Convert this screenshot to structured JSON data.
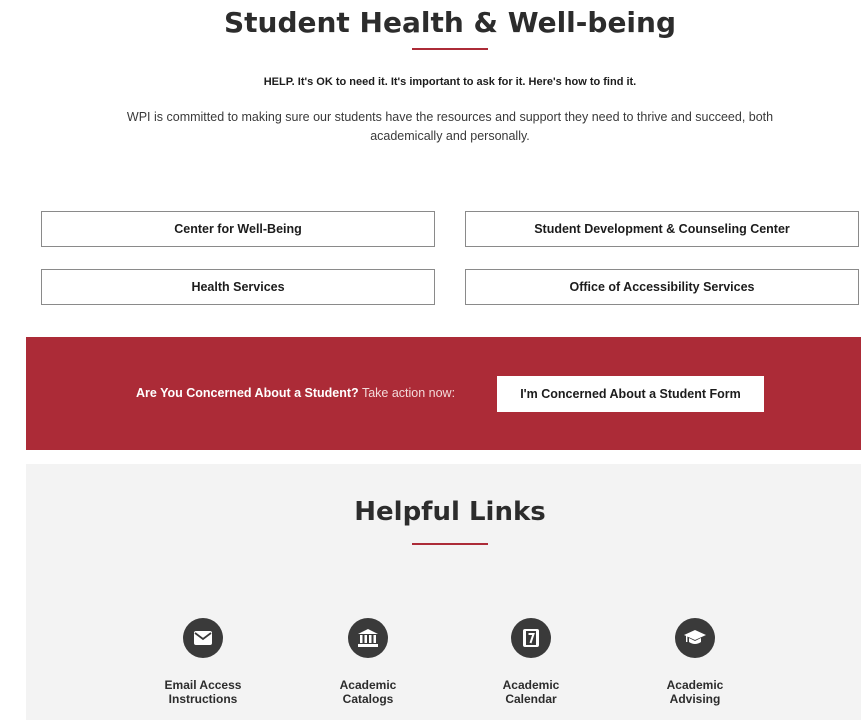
{
  "header": {
    "title": "Student Health & Well-being",
    "help_line": "HELP. It's OK to need it. It's important to ask for it. Here's how to find it.",
    "intro": "WPI is committed to making sure our students have the resources and support they need to thrive and succeed, both academically and personally."
  },
  "resources": [
    {
      "label": "Center for Well-Being"
    },
    {
      "label": "Student Development & Counseling Center"
    },
    {
      "label": "Health Services"
    },
    {
      "label": "Office of Accessibility Services"
    }
  ],
  "concern": {
    "question": "Are You Concerned About a Student?",
    "action_text": "Take action now:",
    "button_label": "I'm Concerned About a Student Form"
  },
  "helpful_links": {
    "title": "Helpful Links",
    "items": [
      {
        "label": "Email Access Instructions",
        "icon": "envelope-icon"
      },
      {
        "label": "Academic Catalogs",
        "icon": "institution-icon"
      },
      {
        "label": "Academic Calendar",
        "icon": "calendar-icon"
      },
      {
        "label": "Academic Advising",
        "icon": "graduation-cap-icon"
      }
    ]
  },
  "colors": {
    "accent": "#ac2b37",
    "panel": "#f3f3f3",
    "icon_circle": "#3a3a3a"
  }
}
